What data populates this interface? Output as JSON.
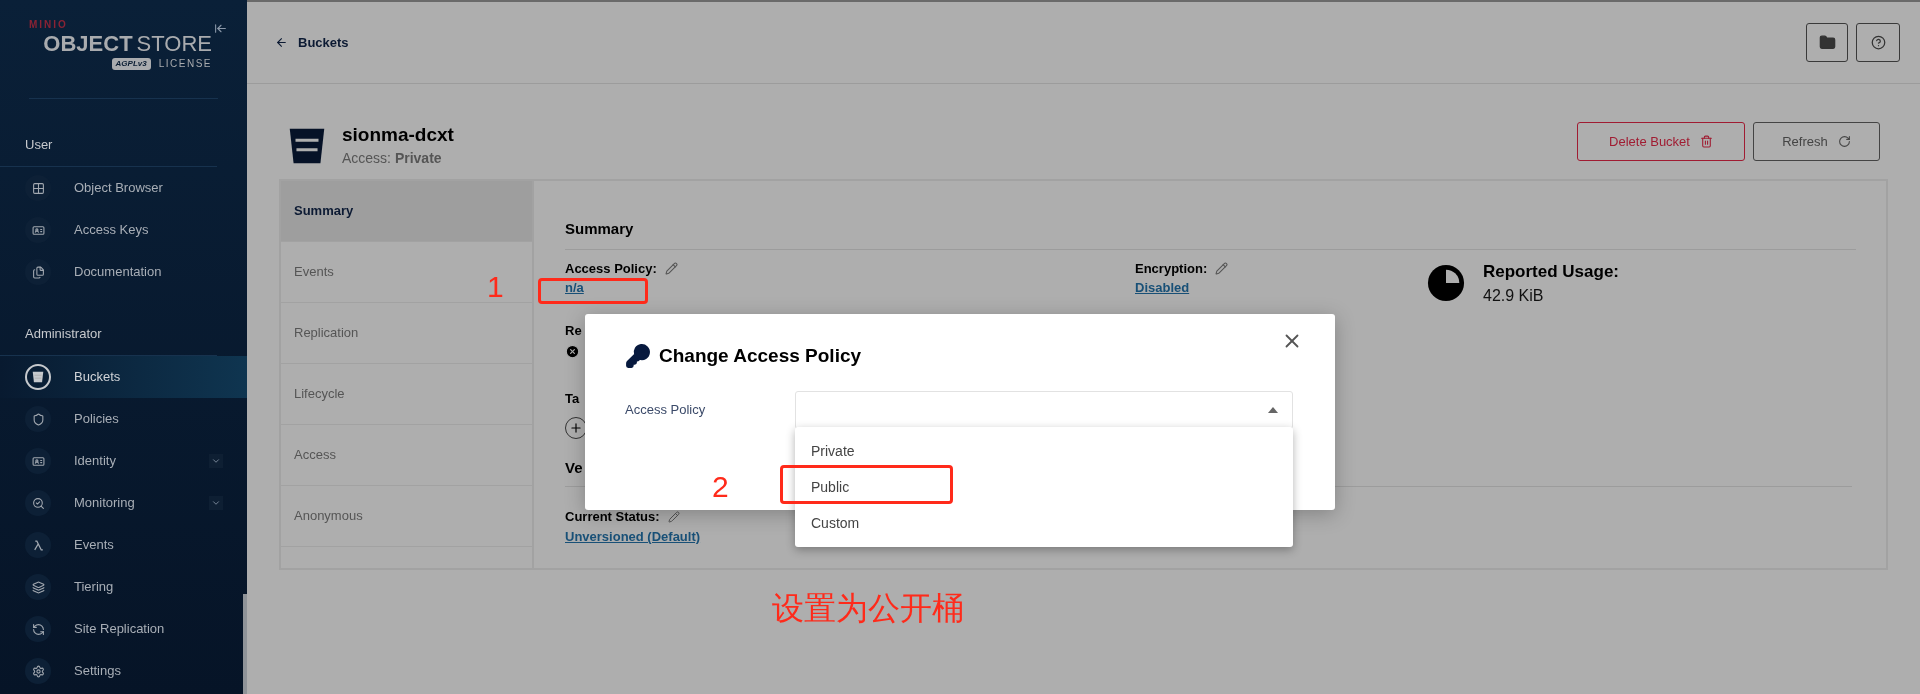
{
  "sidebar": {
    "logo": {
      "brand": "MINIO",
      "product_bold": "OBJECT",
      "product": "STORE",
      "badge": "AGPLv3",
      "license": "LICENSE"
    },
    "sections": [
      {
        "title": "User",
        "items": [
          {
            "label": "Object Browser",
            "selected": false,
            "expandable": false
          },
          {
            "label": "Access Keys",
            "selected": false,
            "expandable": false
          },
          {
            "label": "Documentation",
            "selected": false,
            "expandable": false
          }
        ]
      },
      {
        "title": "Administrator",
        "items": [
          {
            "label": "Buckets",
            "selected": true,
            "expandable": false
          },
          {
            "label": "Policies",
            "selected": false,
            "expandable": false
          },
          {
            "label": "Identity",
            "selected": false,
            "expandable": true
          },
          {
            "label": "Monitoring",
            "selected": false,
            "expandable": true
          },
          {
            "label": "Events",
            "selected": false,
            "expandable": false
          },
          {
            "label": "Tiering",
            "selected": false,
            "expandable": false
          },
          {
            "label": "Site Replication",
            "selected": false,
            "expandable": false
          },
          {
            "label": "Settings",
            "selected": false,
            "expandable": false
          }
        ]
      }
    ]
  },
  "header": {
    "back_label": "Buckets"
  },
  "bucket": {
    "name": "sionma-dcxt",
    "access_label": "Access:",
    "access_value": "Private",
    "buttons": [
      {
        "label": "Delete Bucket",
        "kind": "danger"
      },
      {
        "label": "Refresh",
        "kind": "refresh"
      }
    ]
  },
  "tabs": [
    {
      "label": "Summary",
      "selected": true
    },
    {
      "label": "Events",
      "selected": false
    },
    {
      "label": "Replication",
      "selected": false
    },
    {
      "label": "Lifecycle",
      "selected": false
    },
    {
      "label": "Access",
      "selected": false
    },
    {
      "label": "Anonymous",
      "selected": false
    }
  ],
  "summary": {
    "title": "Summary",
    "access_policy": {
      "label": "Access Policy:",
      "value": "n/a"
    },
    "encryption": {
      "label": "Encryption:",
      "value": "Disabled"
    },
    "usage": {
      "label": "Reported Usage:",
      "value": "42.9 KiB"
    },
    "partial_labels": [
      "Re",
      "Ta",
      "Ve"
    ],
    "versioning": {
      "label": "Current Status:",
      "value": "Unversioned (Default)"
    }
  },
  "modal": {
    "title": "Change Access Policy",
    "field_label": "Access Policy",
    "expanded": true,
    "options": [
      {
        "label": "Private",
        "selected": false
      },
      {
        "label": "Public",
        "selected": false
      },
      {
        "label": "Custom",
        "selected": false
      }
    ]
  },
  "annotations": {
    "markers": [
      "1",
      "2"
    ],
    "caption": "设置为公开桶"
  }
}
